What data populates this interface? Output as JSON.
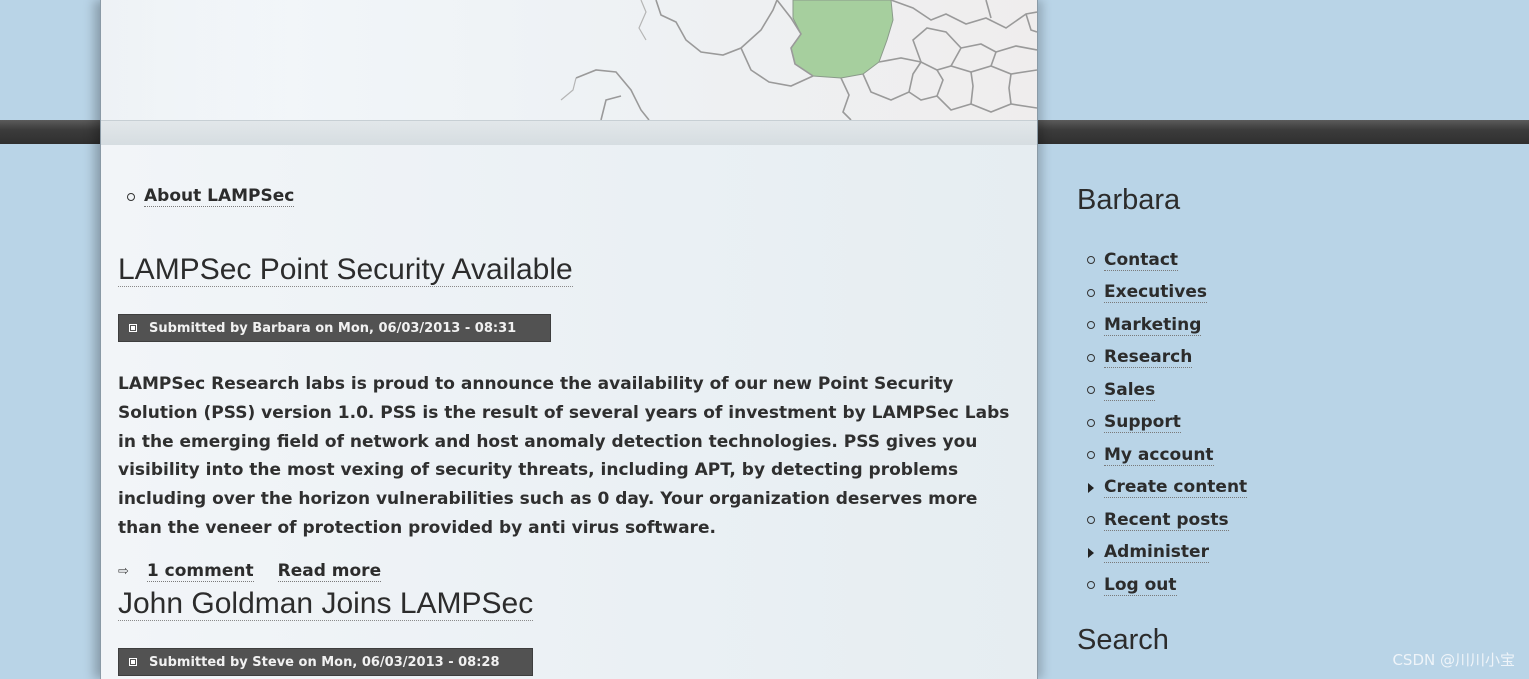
{
  "primary_nav": [
    {
      "label": "About LAMPSec"
    }
  ],
  "posts": [
    {
      "title": "LAMPSec Point Security Available",
      "submitted": "Submitted by Barbara on Mon, 06/03/2013 - 08:31",
      "body": "LAMPSec Research labs is proud to announce the availability of our new Point Security Solution (PSS) version 1.0. PSS is the result of several years of investment by LAMPSec Labs in the emerging field of network and host anomaly detection technologies. PSS gives you visibility into the most vexing of security threats, including APT, by detecting problems including over the horizon vulnerabilities such as 0 day. Your organization deserves more than the veneer of protection provided by anti virus software.",
      "comments_link": "1 comment",
      "read_more_link": "Read more"
    },
    {
      "title": "John Goldman Joins LAMPSec",
      "submitted": "Submitted by Steve on Mon, 06/03/2013 - 08:28"
    }
  ],
  "sidebar": {
    "user_block_title": "Barbara",
    "menu": [
      {
        "label": "Contact",
        "icon": "circle-bullet"
      },
      {
        "label": "Executives",
        "icon": "circle-bullet"
      },
      {
        "label": "Marketing",
        "icon": "circle-bullet"
      },
      {
        "label": "Research",
        "icon": "circle-bullet"
      },
      {
        "label": "Sales",
        "icon": "circle-bullet"
      },
      {
        "label": "Support",
        "icon": "circle-bullet"
      },
      {
        "label": "My account",
        "icon": "circle-bullet"
      },
      {
        "label": "Create content",
        "icon": "triangle-expand"
      },
      {
        "label": "Recent posts",
        "icon": "circle-bullet"
      },
      {
        "label": "Administer",
        "icon": "triangle-expand"
      },
      {
        "label": "Log out",
        "icon": "circle-bullet"
      }
    ],
    "search_block_title": "Search"
  },
  "watermark": "CSDN @川川小宝",
  "colors": {
    "page_background": "#b9d4e7",
    "content_background": "#eaf0f4",
    "dark_band": "#3c3c3c",
    "submitted_bar": "#525252",
    "map_highlight": "#a6cf9e"
  }
}
